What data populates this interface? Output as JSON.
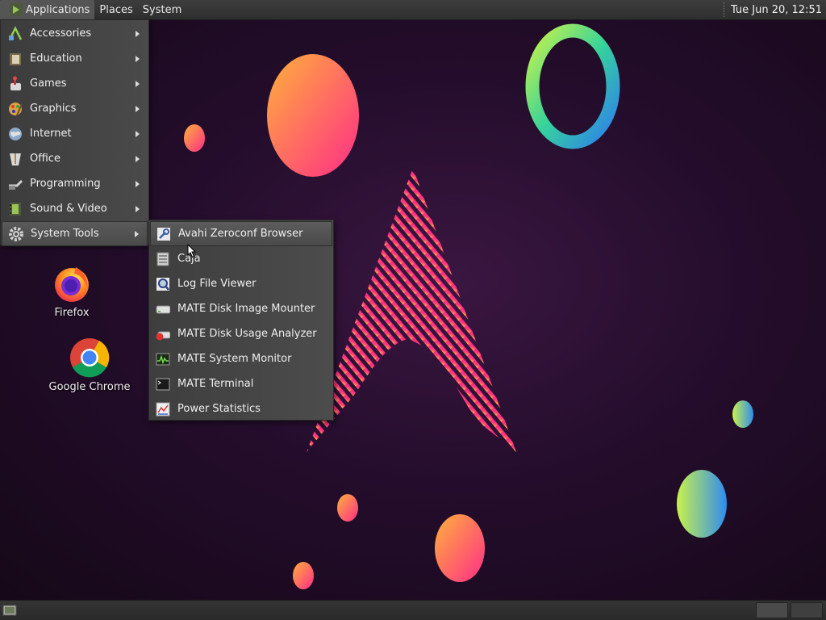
{
  "top_panel": {
    "menus": [
      {
        "label": "Applications"
      },
      {
        "label": "Places"
      },
      {
        "label": "System"
      }
    ],
    "clock": "Tue Jun 20, 12:51"
  },
  "applications_menu": {
    "items": [
      {
        "label": "Accessories",
        "icon": "accessories-icon"
      },
      {
        "label": "Education",
        "icon": "education-icon"
      },
      {
        "label": "Games",
        "icon": "games-icon"
      },
      {
        "label": "Graphics",
        "icon": "graphics-icon"
      },
      {
        "label": "Internet",
        "icon": "internet-icon"
      },
      {
        "label": "Office",
        "icon": "office-icon"
      },
      {
        "label": "Programming",
        "icon": "programming-icon"
      },
      {
        "label": "Sound & Video",
        "icon": "sound-video-icon"
      },
      {
        "label": "System Tools",
        "icon": "system-tools-icon",
        "active": true
      }
    ]
  },
  "system_tools_submenu": {
    "items": [
      {
        "label": "Avahi Zeroconf Browser",
        "icon": "network-wrench-icon",
        "active": true
      },
      {
        "label": "Caja",
        "icon": "file-manager-icon"
      },
      {
        "label": "Log File Viewer",
        "icon": "log-viewer-icon"
      },
      {
        "label": "MATE Disk Image Mounter",
        "icon": "disk-icon"
      },
      {
        "label": "MATE Disk Usage Analyzer",
        "icon": "disk-usage-icon"
      },
      {
        "label": "MATE System Monitor",
        "icon": "system-monitor-icon"
      },
      {
        "label": "MATE Terminal",
        "icon": "terminal-icon"
      },
      {
        "label": "Power Statistics",
        "icon": "power-statistics-icon"
      }
    ]
  },
  "desktop_icons": [
    {
      "label": "Firefox",
      "icon": "firefox-icon"
    },
    {
      "label": "Google Chrome",
      "icon": "chrome-icon"
    }
  ],
  "colors": {
    "panel": "#2e2e2e",
    "menu": "#444444",
    "background": "#1c0b22",
    "accent_orange": "#ff9a3c",
    "accent_pink": "#ff2d87"
  }
}
